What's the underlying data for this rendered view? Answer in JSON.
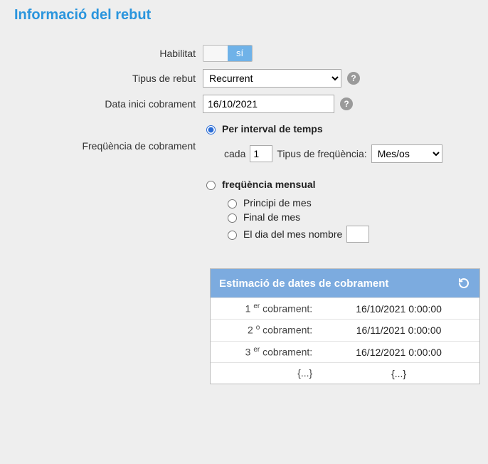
{
  "title": "Informació del rebut",
  "labels": {
    "enabled": "Habilitat",
    "type": "Tipus de rebut",
    "start": "Data inici cobrament",
    "freq": "Freqüència de cobrament",
    "cada": "cada",
    "tfreq": "Tipus de freqüència:"
  },
  "toggle": {
    "on": "sí"
  },
  "type_value": "Recurrent",
  "start_value": "16/10/2021",
  "interval": {
    "mode_interval": "Per interval de temps",
    "mode_monthly": "freqüència mensual",
    "every_value": "1",
    "freq_value": "Mes/os"
  },
  "monthly": {
    "start": "Principi de mes",
    "end": "Final de mes",
    "daynum": "El dia del mes nombre"
  },
  "est": {
    "header": "Estimació de dates de cobrament",
    "rows": [
      {
        "label": "1 <sup>er</sup> cobrament:",
        "val": "16/10/2021 0:00:00"
      },
      {
        "label": "2 <sup>o</sup> cobrament:",
        "val": "16/11/2021 0:00:00"
      },
      {
        "label": "3 <sup>er</sup> cobrament:",
        "val": "16/12/2021 0:00:00"
      },
      {
        "label": "{...}",
        "val": "{...}"
      }
    ]
  }
}
